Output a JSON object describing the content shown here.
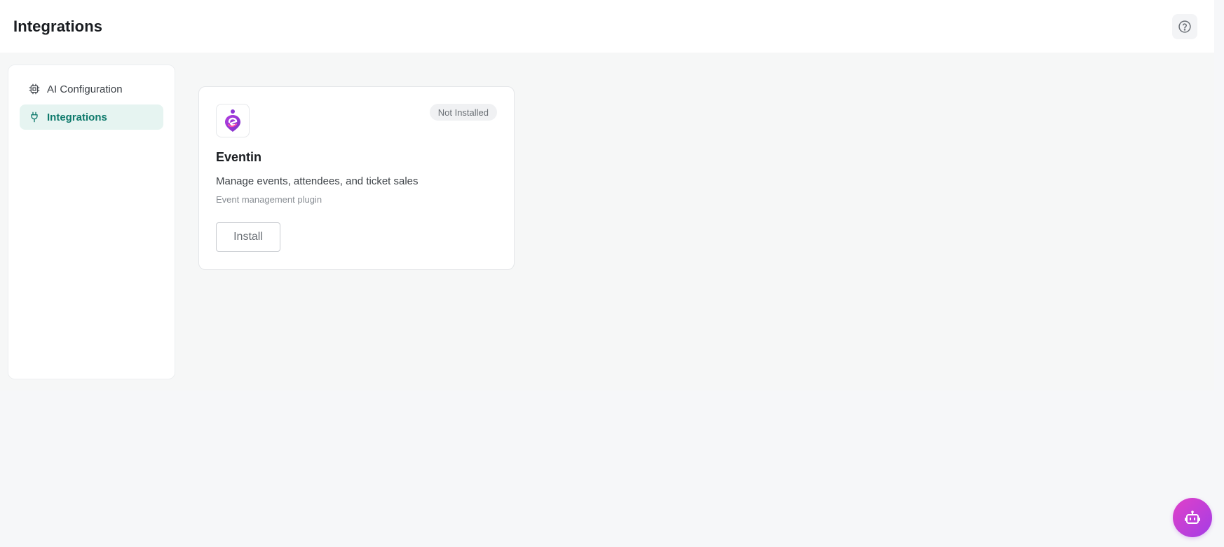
{
  "header": {
    "title": "Integrations",
    "help_icon": "help-circle-icon"
  },
  "sidebar": {
    "items": [
      {
        "label": "AI Configuration",
        "icon": "cpu-chip-icon",
        "active": false
      },
      {
        "label": "Integrations",
        "icon": "plug-icon",
        "active": true
      }
    ]
  },
  "integrations": [
    {
      "name": "Eventin",
      "status": "Not Installed",
      "description": "Manage events, attendees, and ticket sales",
      "subtitle": "Event management plugin",
      "action_label": "Install",
      "logo_icon": "eventin-logo-icon"
    }
  ],
  "fab": {
    "icon": "bot-icon"
  },
  "colors": {
    "accent": "#0f7a6c",
    "accent_bg": "#e6f4f1",
    "fab_gradient_start": "#e040c8",
    "fab_gradient_end": "#a43ee6"
  }
}
